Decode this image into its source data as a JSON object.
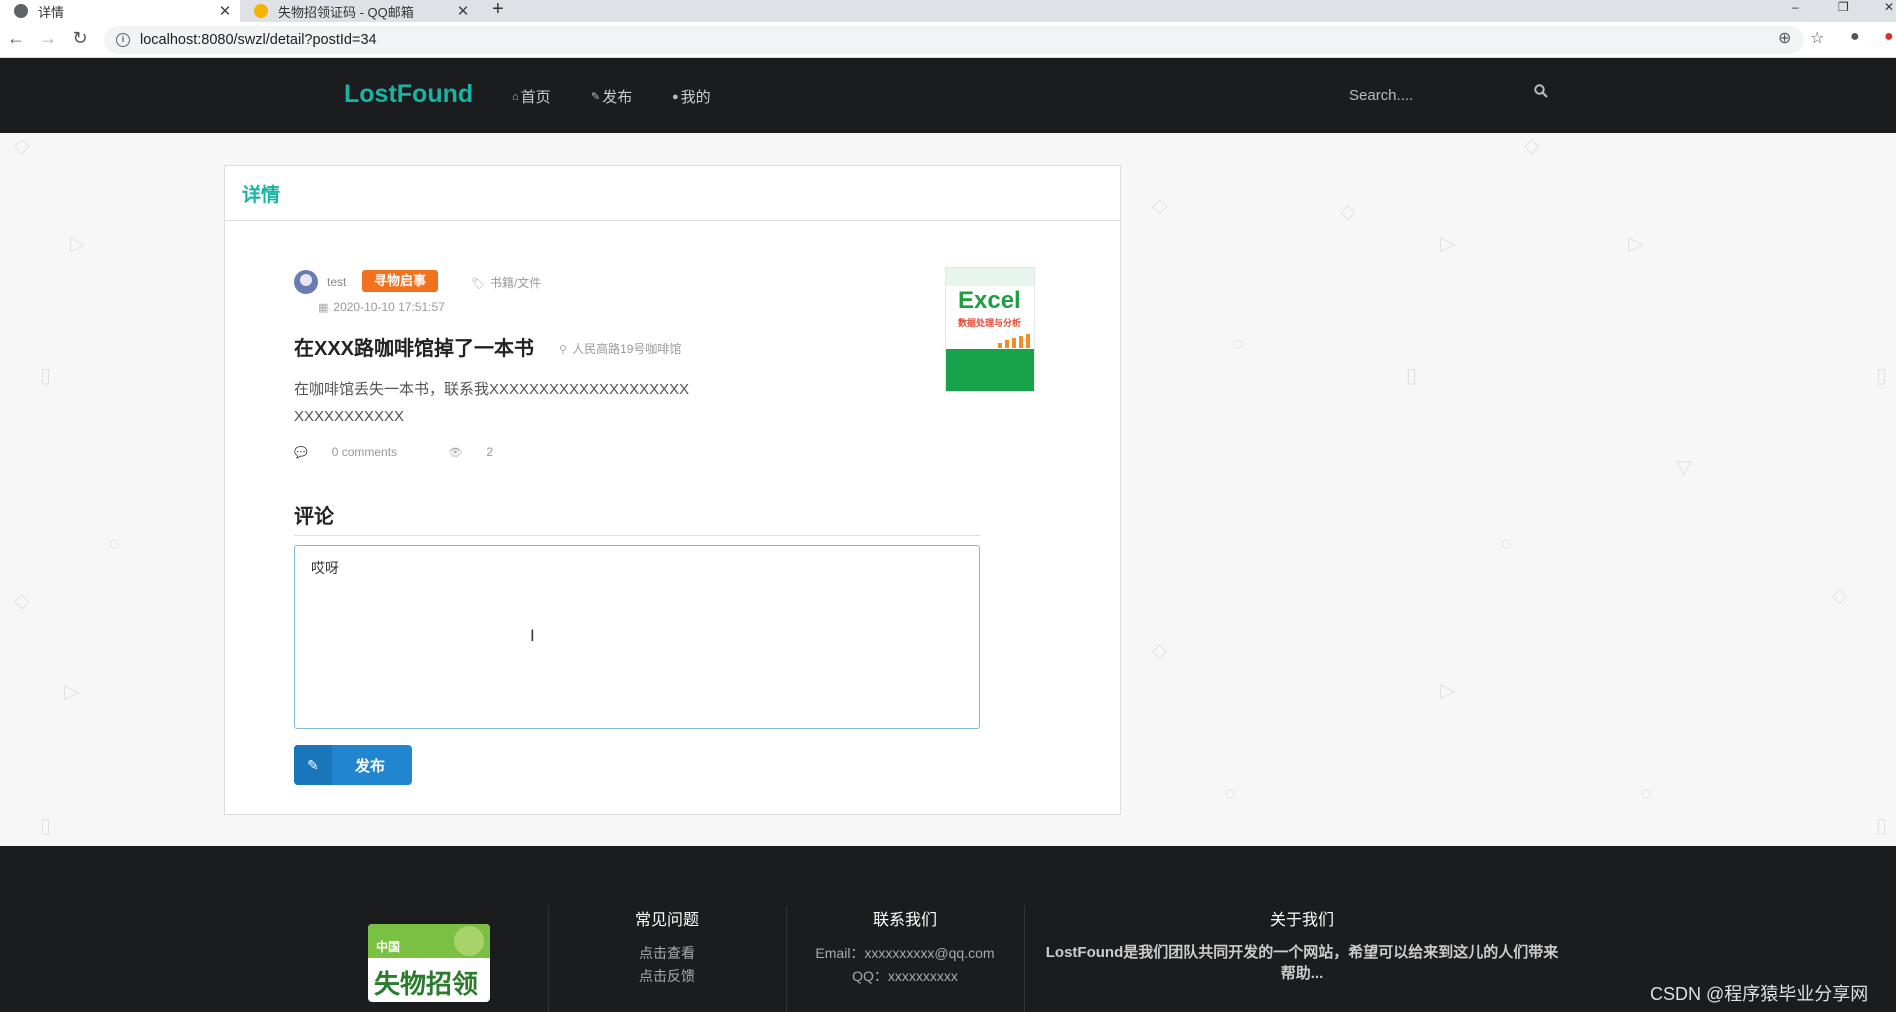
{
  "browser": {
    "tabs": [
      {
        "title": "详情",
        "active": true
      },
      {
        "title": "失物招领证码 - QQ邮箱",
        "active": false
      }
    ],
    "new_tab": "+",
    "url": "localhost:8080/swzl/detail?postId=34"
  },
  "header": {
    "brand": "LostFound",
    "nav": [
      {
        "label": "首页",
        "icon": "home-icon"
      },
      {
        "label": "发布",
        "icon": "edit-icon"
      },
      {
        "label": "我的",
        "icon": "user-icon"
      }
    ],
    "search_placeholder": "Search...."
  },
  "card": {
    "title": "详情",
    "author": "test",
    "type_badge": "寻物启事",
    "category": "书籍/文件",
    "date": "2020-10-10 17:51:57",
    "post_title": "在XXX路咖啡馆掉了一本书",
    "location": "人民高路19号咖啡馆",
    "body": "在咖啡馆丢失一本书，联系我XXXXXXXXXXXXXXXXXXXXXXXXXXXXXXX",
    "comments": "0 comments",
    "views": "2",
    "book_title": "Excel",
    "book_subtitle": "数据处理与分析",
    "comment_heading": "评论",
    "comment_value": "哎呀",
    "publish_label": "发布"
  },
  "footer": {
    "logo_top": "中国",
    "logo_main": "失物招领",
    "faq": {
      "heading": "常见问题",
      "links": [
        "点击查看",
        "点击反馈"
      ]
    },
    "contact": {
      "heading": "联系我们",
      "email": "Email：xxxxxxxxxx@qq.com",
      "qq": "QQ：xxxxxxxxxx"
    },
    "about": {
      "heading": "关于我们",
      "text": "LostFound是我们团队共同开发的一个网站，希望可以给来到这儿的人们带来帮助..."
    }
  },
  "watermark": "CSDN @程序猿毕业分享网",
  "colors": {
    "brand": "#19b3a4",
    "badge": "#f2711c",
    "button": "#2185d0",
    "header_bg": "#1b1c1d"
  }
}
